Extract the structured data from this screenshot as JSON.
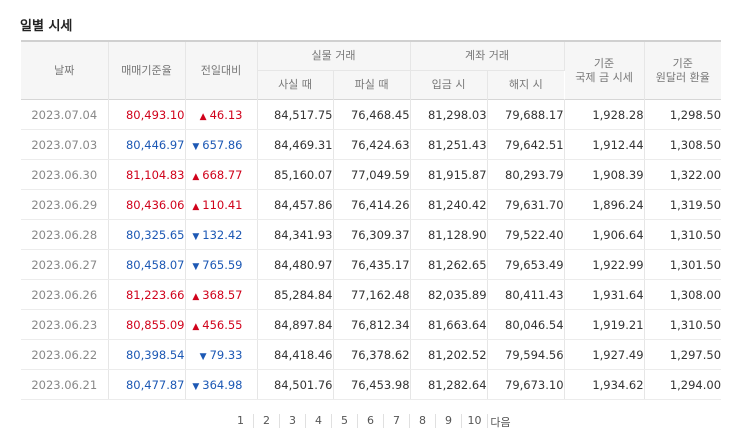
{
  "title": "일별 시세",
  "headers": {
    "date": "날짜",
    "base_rate": "매매기준율",
    "change": "전일대비",
    "cash_group": "실물 거래",
    "cash_buy": "사실 때",
    "cash_sell": "파실 때",
    "account_group": "계좌 거래",
    "deposit": "입금 시",
    "withdraw": "해지 시",
    "intl_gold_line1": "기준",
    "intl_gold_line2": "국제 금 시세",
    "krw_usd_line1": "기준",
    "krw_usd_line2": "원달러 환율"
  },
  "rows": [
    {
      "date": "2023.07.04",
      "base_rate": "80,493.10",
      "direction": "up",
      "change": "46.13",
      "cash_buy": "84,517.75",
      "cash_sell": "76,468.45",
      "deposit": "81,298.03",
      "withdraw": "79,688.17",
      "intl_gold": "1,928.28",
      "krw_usd": "1,298.50"
    },
    {
      "date": "2023.07.03",
      "base_rate": "80,446.97",
      "direction": "down",
      "change": "657.86",
      "cash_buy": "84,469.31",
      "cash_sell": "76,424.63",
      "deposit": "81,251.43",
      "withdraw": "79,642.51",
      "intl_gold": "1,912.44",
      "krw_usd": "1,308.50"
    },
    {
      "date": "2023.06.30",
      "base_rate": "81,104.83",
      "direction": "up",
      "change": "668.77",
      "cash_buy": "85,160.07",
      "cash_sell": "77,049.59",
      "deposit": "81,915.87",
      "withdraw": "80,293.79",
      "intl_gold": "1,908.39",
      "krw_usd": "1,322.00"
    },
    {
      "date": "2023.06.29",
      "base_rate": "80,436.06",
      "direction": "up",
      "change": "110.41",
      "cash_buy": "84,457.86",
      "cash_sell": "76,414.26",
      "deposit": "81,240.42",
      "withdraw": "79,631.70",
      "intl_gold": "1,896.24",
      "krw_usd": "1,319.50"
    },
    {
      "date": "2023.06.28",
      "base_rate": "80,325.65",
      "direction": "down",
      "change": "132.42",
      "cash_buy": "84,341.93",
      "cash_sell": "76,309.37",
      "deposit": "81,128.90",
      "withdraw": "79,522.40",
      "intl_gold": "1,906.64",
      "krw_usd": "1,310.50"
    },
    {
      "date": "2023.06.27",
      "base_rate": "80,458.07",
      "direction": "down",
      "change": "765.59",
      "cash_buy": "84,480.97",
      "cash_sell": "76,435.17",
      "deposit": "81,262.65",
      "withdraw": "79,653.49",
      "intl_gold": "1,922.99",
      "krw_usd": "1,301.50"
    },
    {
      "date": "2023.06.26",
      "base_rate": "81,223.66",
      "direction": "up",
      "change": "368.57",
      "cash_buy": "85,284.84",
      "cash_sell": "77,162.48",
      "deposit": "82,035.89",
      "withdraw": "80,411.43",
      "intl_gold": "1,931.64",
      "krw_usd": "1,308.00"
    },
    {
      "date": "2023.06.23",
      "base_rate": "80,855.09",
      "direction": "up",
      "change": "456.55",
      "cash_buy": "84,897.84",
      "cash_sell": "76,812.34",
      "deposit": "81,663.64",
      "withdraw": "80,046.54",
      "intl_gold": "1,919.21",
      "krw_usd": "1,310.50"
    },
    {
      "date": "2023.06.22",
      "base_rate": "80,398.54",
      "direction": "down",
      "change": "79.33",
      "cash_buy": "84,418.46",
      "cash_sell": "76,378.62",
      "deposit": "81,202.52",
      "withdraw": "79,594.56",
      "intl_gold": "1,927.49",
      "krw_usd": "1,297.50"
    },
    {
      "date": "2023.06.21",
      "base_rate": "80,477.87",
      "direction": "down",
      "change": "364.98",
      "cash_buy": "84,501.76",
      "cash_sell": "76,453.98",
      "deposit": "81,282.64",
      "withdraw": "79,673.10",
      "intl_gold": "1,934.62",
      "krw_usd": "1,294.00"
    }
  ],
  "arrows": {
    "up": "▲",
    "down": "▼"
  },
  "colors": {
    "up": "#d0021b",
    "down": "#1c58b4"
  },
  "pagination": [
    "1",
    "2",
    "3",
    "4",
    "5",
    "6",
    "7",
    "8",
    "9",
    "10",
    "다음"
  ]
}
